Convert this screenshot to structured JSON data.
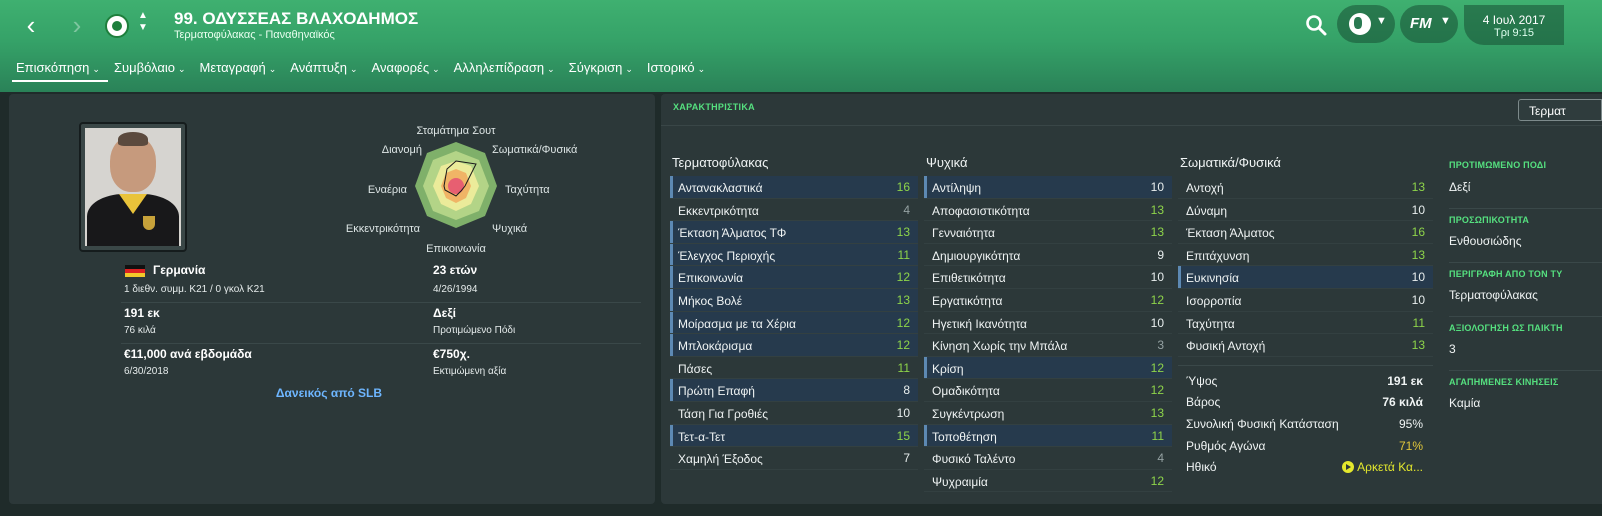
{
  "header": {
    "player_name": "99. ΟΔΥΣΣΕΑΣ ΒΛΑΧΟΔΗΜΟΣ",
    "subtitle": "Τερματοφύλακας - Παναθηναϊκός",
    "date": "4 Ιουλ 2017",
    "time": "Τρι 9:15",
    "fm_logo": "FM",
    "back_glyph": "‹",
    "forward_glyph": "›",
    "icons": [
      "back-arrow-icon",
      "forward-arrow-icon",
      "club-badge-icon",
      "search-icon",
      "globe-icon",
      "fm-logo-icon"
    ],
    "accent_color": "#3fb070"
  },
  "tabs": [
    {
      "label": "Επισκόπηση",
      "active": true
    },
    {
      "label": "Συμβόλαιο"
    },
    {
      "label": "Μεταγραφή"
    },
    {
      "label": "Ανάπτυξη"
    },
    {
      "label": "Αναφορές"
    },
    {
      "label": "Αλληλεπίδραση"
    },
    {
      "label": "Σύγκριση"
    },
    {
      "label": "Ιστορικό"
    }
  ],
  "overview": {
    "radar_labels": [
      "Σταμάτημα Σουτ",
      "Σωματικά/Φυσικά",
      "Ταχύτητα",
      "Ψυχικά",
      "Επικοινωνία",
      "Εκκεντρικότητα",
      "Εναέρια",
      "Διανομή"
    ],
    "nationality": "Γερμανία",
    "caps": "1 διεθν. συμμ. Κ21 / 0 γκολ Κ21",
    "age": "23 ετών",
    "dob": "4/26/1994",
    "height": "191 εκ",
    "weight": "76 κιλά",
    "foot": "Δεξί",
    "foot_label": "Προτιμώμενο Πόδι",
    "wage": "€11,000 ανά εβδομάδα",
    "contract_end": "6/30/2018",
    "value": "€750χ.",
    "value_label": "Εκτιμώμενη αξία",
    "loan": "Δανεικός από SLB"
  },
  "attributes": {
    "title": "ΧΑΡΑΚΤΗΡΙΣΤΙΚΑ",
    "filter_button": "Τερματ",
    "goalkeeping": {
      "header": "Τερματοφύλακας",
      "rows": [
        {
          "name": "Αντανακλαστικά",
          "value": "16",
          "hl": true
        },
        {
          "name": "Εκκεντρικότητα",
          "value": "4",
          "hl": false
        },
        {
          "name": "Έκταση Άλματος ΤΦ",
          "value": "13",
          "hl": true
        },
        {
          "name": "Έλεγχος Περιοχής",
          "value": "11",
          "hl": true
        },
        {
          "name": "Επικοινωνία",
          "value": "12",
          "hl": true
        },
        {
          "name": "Μήκος Βολέ",
          "value": "13",
          "hl": true
        },
        {
          "name": "Μοίρασμα με τα Χέρια",
          "value": "12",
          "hl": true
        },
        {
          "name": "Μπλοκάρισμα",
          "value": "12",
          "hl": true
        },
        {
          "name": "Πάσες",
          "value": "11",
          "hl": false
        },
        {
          "name": "Πρώτη Επαφή",
          "value": "8",
          "hl": true
        },
        {
          "name": "Τάση Για Γροθιές",
          "value": "10",
          "hl": false
        },
        {
          "name": "Τετ-α-Τετ",
          "value": "15",
          "hl": true
        },
        {
          "name": "Χαμηλή Έξοδος",
          "value": "7",
          "hl": false
        }
      ]
    },
    "mental": {
      "header": "Ψυχικά",
      "rows": [
        {
          "name": "Αντίληψη",
          "value": "10",
          "hl": true
        },
        {
          "name": "Αποφασιστικότητα",
          "value": "13",
          "hl": false
        },
        {
          "name": "Γενναιότητα",
          "value": "13",
          "hl": false
        },
        {
          "name": "Δημιουργικότητα",
          "value": "9",
          "hl": false
        },
        {
          "name": "Επιθετικότητα",
          "value": "10",
          "hl": false
        },
        {
          "name": "Εργατικότητα",
          "value": "12",
          "hl": false
        },
        {
          "name": "Ηγετική Ικανότητα",
          "value": "10",
          "hl": false
        },
        {
          "name": "Κίνηση Χωρίς την Μπάλα",
          "value": "3",
          "hl": false
        },
        {
          "name": "Κρίση",
          "value": "12",
          "hl": true
        },
        {
          "name": "Ομαδικότητα",
          "value": "12",
          "hl": false
        },
        {
          "name": "Συγκέντρωση",
          "value": "13",
          "hl": false
        },
        {
          "name": "Τοποθέτηση",
          "value": "11",
          "hl": true
        },
        {
          "name": "Φυσικό Ταλέντο",
          "value": "4",
          "hl": false
        },
        {
          "name": "Ψυχραιμία",
          "value": "12",
          "hl": false
        }
      ]
    },
    "physical": {
      "header": "Σωματικά/Φυσικά",
      "rows": [
        {
          "name": "Αντοχή",
          "value": "13",
          "hl": false
        },
        {
          "name": "Δύναμη",
          "value": "10",
          "hl": false
        },
        {
          "name": "Έκταση Άλματος",
          "value": "16",
          "hl": false
        },
        {
          "name": "Επιτάχυνση",
          "value": "13",
          "hl": false
        },
        {
          "name": "Ευκινησία",
          "value": "10",
          "hl": true
        },
        {
          "name": "Ισορροπία",
          "value": "10",
          "hl": false
        },
        {
          "name": "Ταχύτητα",
          "value": "11",
          "hl": false
        },
        {
          "name": "Φυσική Αντοχή",
          "value": "13",
          "hl": false
        }
      ],
      "details": [
        {
          "name": "Ύψος",
          "value": "191 εκ"
        },
        {
          "name": "Βάρος",
          "value": "76 κιλά"
        },
        {
          "name": "Συνολική Φυσική Κατάσταση",
          "value": "95%"
        },
        {
          "name": "Ρυθμός Αγώνα",
          "value": "71%"
        },
        {
          "name": "Ηθικό",
          "value": "Αρκετά Κα..."
        }
      ]
    },
    "side": [
      {
        "header": "ΠΡΟΤΙΜΩΜΕΝΟ ΠΟΔΙ",
        "value": "Δεξί"
      },
      {
        "header": "ΠΡΟΣΩΠΙΚΟΤΗΤΑ",
        "value": "Ενθουσιώδης"
      },
      {
        "header": "ΠΕΡΙΓΡΑΦΗ ΑΠΟ ΤΟΝ ΤΥ",
        "value": "Τερματοφύλακας"
      },
      {
        "header": "ΑΞΙΟΛΟΓΗΣΗ ΩΣ ΠΑΙΚΤΗ",
        "value": "3"
      },
      {
        "header": "ΑΓΑΠΗΜΕΝΕΣ ΚΙΝΗΣΕΙΣ",
        "value": "Καμία"
      }
    ]
  },
  "colors": {
    "good": "#8ed44a",
    "normal": "#e8eeee",
    "poor": "#95a2a3",
    "highlight_row": "#263a4d",
    "loan_link": "#6eb6ff",
    "section_green": "#55e07f",
    "warn": "#e2c83a"
  }
}
